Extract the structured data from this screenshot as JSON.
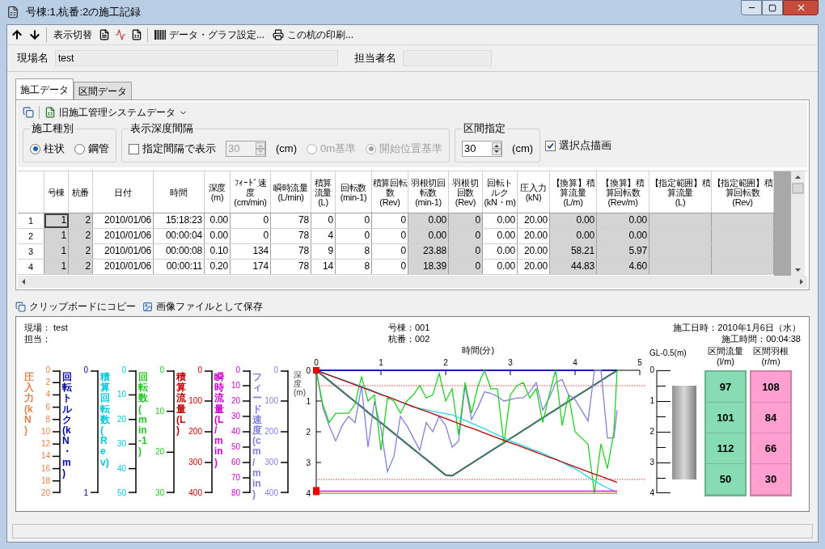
{
  "window": {
    "title": "号棟:1,杭番:2の施工記録"
  },
  "toolbar": {
    "view_toggle": "表示切替",
    "settings": "データ・グラフ設定...",
    "print": "この杭の印刷..."
  },
  "fields": [
    {
      "label": "現場名",
      "value": "test"
    },
    {
      "label": "担当者名"
    }
  ],
  "tabs": [
    {
      "label": "施工データ",
      "selected": true
    },
    {
      "label": "区間データ",
      "selected": false
    }
  ],
  "data_source": "旧施工管理システムデータ",
  "construction_type": {
    "title": "施工種別",
    "options": [
      {
        "label": "柱状",
        "selected": true
      },
      {
        "label": "鋼管",
        "selected": false
      }
    ]
  },
  "depth_interval": {
    "title": "表示深度間隔",
    "checkbox": {
      "label": "指定間隔で表示",
      "checked": false
    },
    "spin": {
      "value": "30",
      "disabled": true
    },
    "unit": "(cm)",
    "options": [
      {
        "label": "0m基準",
        "selected": false,
        "disabled": true
      },
      {
        "label": "開始位置基準",
        "selected": true,
        "disabled": true
      }
    ]
  },
  "section": {
    "title": "区間指定",
    "spin": {
      "value": "30",
      "disabled": false
    },
    "unit": "(cm)"
  },
  "draw_selected": {
    "label": "選択点描画",
    "checked": true
  },
  "table": {
    "columns": [
      {
        "label": "号棟",
        "shaded": true
      },
      {
        "label": "杭番",
        "shaded": true
      },
      {
        "label": "日付",
        "shaded": false
      },
      {
        "label": "時間",
        "shaded": false
      },
      {
        "label": "深度\n(m)",
        "shaded": false
      },
      {
        "label": "ﾌｨｰﾄﾞ速度\n(cm/min)",
        "shaded": false
      },
      {
        "label": "瞬時流量\n(L/min)",
        "shaded": false
      },
      {
        "label": "積算流量\n(L)",
        "shaded": false
      },
      {
        "label": "回転数\n(min-1)",
        "shaded": false
      },
      {
        "label": "積算回転数\n(Rev)",
        "shaded": false
      },
      {
        "label": "羽根切回転数\n(min-1)",
        "shaded": true
      },
      {
        "label": "羽根切回数\n(Rev)",
        "shaded": true
      },
      {
        "label": "回転トルク\n(kN・m)",
        "shaded": false
      },
      {
        "label": "圧入力\n(kN)",
        "shaded": false
      },
      {
        "label": "【換算】積算流量\n(L/m)",
        "shaded": true
      },
      {
        "label": "【換算】積算回転数\n(Rev/m)",
        "shaded": true
      },
      {
        "label": "【指定範囲】積算流量\n(L)",
        "shaded": true
      },
      {
        "label": "【指定範囲】積算回転数\n(Rev)",
        "shaded": true
      }
    ],
    "rows": [
      {
        "label": "1",
        "selected": true,
        "cells": [
          "1",
          "2",
          "2010/01/06",
          "15:18:23",
          "0.00",
          "0",
          "78",
          "0",
          "0",
          "0",
          "0.00",
          "0",
          "0.00",
          "20.00",
          "0.00",
          "0.00"
        ]
      },
      {
        "label": "2",
        "selected": false,
        "cells": [
          "1",
          "2",
          "2010/01/06",
          "00:00:04",
          "0.00",
          "0",
          "78",
          "4",
          "0",
          "0",
          "0.00",
          "0",
          "0.00",
          "20.00",
          "0.00",
          "0.00"
        ]
      },
      {
        "label": "3",
        "selected": false,
        "cells": [
          "1",
          "2",
          "2010/01/06",
          "00:00:08",
          "0.10",
          "134",
          "78",
          "9",
          "8",
          "0",
          "23.88",
          "0",
          "0.00",
          "20.00",
          "58.21",
          "5.97"
        ]
      },
      {
        "label": "4",
        "selected": false,
        "cells": [
          "1",
          "2",
          "2010/01/06",
          "00:00:11",
          "0.20",
          "174",
          "78",
          "14",
          "8",
          "0",
          "18.39",
          "0",
          "0.00",
          "20.00",
          "44.83",
          "4.60"
        ]
      }
    ]
  },
  "export": {
    "copy": "クリップボードにコピー",
    "save": "画像ファイルとして保存"
  },
  "report": {
    "site": "現場： test",
    "manager": "担当：",
    "building": "号棟：001",
    "pile": "杭番：002",
    "date": "施工日時：2010年1月6日（水）",
    "duration": "施工時間：00:04:38",
    "axes": [
      {
        "title": "圧入力(kN)",
        "color": "#e8804a",
        "ticks": [
          "0",
          "2",
          "4",
          "6",
          "8",
          "10",
          "12",
          "14",
          "16",
          "18",
          "20"
        ]
      },
      {
        "title": "回転トルク(kN・m)",
        "color": "#0000a8",
        "ticks": [
          "0",
          "1"
        ]
      },
      {
        "title": "積算回転数(Rev)",
        "color": "#00c8dc",
        "ticks": [
          "0",
          "10",
          "20",
          "30",
          "40",
          "50"
        ]
      },
      {
        "title": "回転数(min-1)",
        "color": "#20c820",
        "ticks": [
          "0",
          "10",
          "20",
          "30"
        ]
      },
      {
        "title": "積算流量(L)",
        "color": "#c80000",
        "ticks": [
          "0",
          "100",
          "200",
          "300",
          "400"
        ]
      },
      {
        "title": "瞬時流量(L/min)",
        "color": "#d000d0",
        "ticks": [
          "0",
          "10",
          "20",
          "30",
          "40",
          "50",
          "60",
          "70",
          "80"
        ]
      },
      {
        "title": "フィード速度(cm/min)",
        "color": "#8080dc",
        "ticks": [
          "0",
          "100",
          "200",
          "300",
          "400"
        ]
      }
    ],
    "chart_data": {
      "type": "line",
      "xlabel": "時間(分)",
      "ylabel": "深度(m)",
      "xlim": [
        0,
        5
      ],
      "ylim": [
        4,
        0
      ],
      "xticks": [
        0,
        1,
        2,
        3,
        4,
        5
      ],
      "yticks": [
        0,
        1,
        2,
        3,
        4
      ],
      "ref_lines": [
        {
          "axis": "y",
          "value": 0.5,
          "color": "#d04040"
        },
        {
          "axis": "y",
          "value": 3.55,
          "color": "#d04040"
        }
      ],
      "x": [
        0,
        0.1,
        0.2,
        0.3,
        0.4,
        0.5,
        0.6,
        0.7,
        0.8,
        0.9,
        1,
        1.1,
        1.2,
        1.3,
        1.4,
        1.5,
        1.6,
        1.7,
        1.8,
        1.9,
        2,
        2.1,
        2.2,
        2.3,
        2.4,
        2.5,
        2.6,
        2.7,
        2.8,
        2.9,
        3,
        3.1,
        3.2,
        3.3,
        3.4,
        3.5,
        3.6,
        3.7,
        3.8,
        3.9,
        4,
        4.1,
        4.2,
        4.3,
        4.4,
        4.5,
        4.6,
        4.65
      ],
      "series": [
        {
          "color": "#40706a",
          "values": [
            0,
            0.17,
            0.34,
            0.51,
            0.68,
            0.85,
            1.02,
            1.19,
            1.37,
            1.54,
            1.71,
            1.88,
            2.05,
            2.22,
            2.39,
            2.56,
            2.73,
            2.9,
            3.07,
            3.24,
            3.41,
            3.43,
            3.3,
            3.16,
            3.03,
            2.89,
            2.76,
            2.62,
            2.49,
            2.36,
            2.22,
            2.09,
            1.95,
            1.82,
            1.68,
            1.55,
            1.41,
            1.28,
            1.14,
            1.01,
            0.87,
            0.74,
            0.61,
            0.47,
            0.34,
            0.2,
            0.07,
            0
          ]
        },
        {
          "color": "#0000a8",
          "values": [
            0,
            0,
            0,
            0,
            0,
            0,
            0,
            0,
            0,
            0,
            0,
            0,
            0,
            0,
            0,
            0,
            0,
            0,
            0,
            0,
            0,
            0,
            0,
            0,
            0,
            0,
            0,
            0,
            0,
            0,
            0,
            0,
            0,
            0,
            0,
            0,
            0,
            0,
            0,
            0,
            0,
            0,
            0,
            0,
            0,
            0,
            0,
            0
          ]
        },
        {
          "color": "#8080dc",
          "values": [
            0,
            1.2,
            1.8,
            2.3,
            1.8,
            1.5,
            1.7,
            0.5,
            2.5,
            1,
            1.9,
            3.3,
            2.8,
            1.5,
            1.8,
            2.2,
            2.6,
            1.7,
            2,
            1.5,
            1.8,
            2.5,
            2.3,
            0.5,
            1.6,
            1.2,
            0.7,
            0.75,
            0.85,
            1,
            0.95,
            0.9,
            0.9,
            0.7,
            0.4,
            1.3,
            0.9,
            0.4,
            0.3,
            0.8,
            0.95,
            1.3,
            1.65,
            0,
            0,
            2.2,
            2.2,
            1.3
          ]
        },
        {
          "color": "#20d020",
          "values": [
            0,
            1.1,
            1.7,
            1.4,
            1.4,
            1.4,
            1.1,
            0.2,
            1,
            0.8,
            2.6,
            0.9,
            1,
            1.4,
            1,
            0.8,
            0.5,
            0.9,
            0.8,
            0.1,
            1,
            0.6,
            2.1,
            0.4,
            1.4,
            0.5,
            0,
            0.6,
            0.6,
            2.4,
            0.8,
            0.5,
            0.4,
            0.9,
            0.6,
            1.7,
            0.8,
            0,
            1.8,
            0.8,
            2,
            2.2,
            2.4,
            4,
            2.4,
            3.2,
            2,
            0
          ]
        },
        {
          "color": "#20d8e8",
          "values": [
            0,
            0.07,
            0.15,
            0.22,
            0.3,
            0.37,
            0.45,
            0.52,
            0.6,
            0.69,
            0.77,
            0.86,
            0.94,
            1.03,
            1.11,
            1.2,
            1.24,
            1.28,
            1.33,
            1.37,
            1.41,
            1.45,
            1.54,
            1.63,
            1.72,
            1.81,
            1.9,
            2,
            2.1,
            2.2,
            2.3,
            2.38,
            2.46,
            2.54,
            2.62,
            2.7,
            2.8,
            2.9,
            3,
            3.1,
            3.2,
            3.33,
            3.47,
            3.6,
            3.72,
            3.83,
            3.93,
            3.95
          ]
        },
        {
          "color": "#c00000",
          "values": [
            0,
            0.08,
            0.16,
            0.24,
            0.31,
            0.39,
            0.47,
            0.55,
            0.63,
            0.71,
            0.79,
            0.86,
            0.94,
            1.02,
            1.1,
            1.18,
            1.26,
            1.33,
            1.41,
            1.49,
            1.57,
            1.65,
            1.73,
            1.81,
            1.88,
            1.96,
            2.04,
            2.12,
            2.2,
            2.28,
            2.36,
            2.43,
            2.51,
            2.59,
            2.67,
            2.75,
            2.83,
            2.9,
            2.98,
            3.06,
            3.14,
            3.22,
            3.3,
            3.38,
            3.45,
            3.53,
            3.61,
            3.65
          ]
        },
        {
          "color": "#d000d0",
          "values": [
            3.93,
            3.93,
            3.93,
            3.93,
            3.93,
            3.93,
            3.93,
            3.93,
            3.93,
            3.93,
            3.93,
            3.93,
            3.93,
            3.93,
            3.93,
            3.93,
            3.93,
            3.93,
            3.93,
            3.93,
            3.93,
            3.93,
            3.93,
            3.93,
            3.93,
            3.93,
            3.93,
            3.93,
            3.93,
            3.93,
            3.93,
            3.93,
            3.93,
            3.93,
            3.93,
            3.93,
            3.93,
            3.93,
            3.93,
            3.93,
            3.93,
            3.93,
            3.93,
            3.93,
            3.93,
            3.93,
            3.93,
            3.93
          ]
        },
        {
          "color": "#e8804a",
          "values": [
            4,
            4,
            4,
            4,
            4,
            4,
            4,
            4,
            4,
            4,
            4,
            4,
            4,
            4,
            4,
            4,
            4,
            4,
            4,
            4,
            4,
            4,
            4,
            4,
            4,
            4,
            4,
            4,
            4,
            4,
            4,
            4,
            4,
            4,
            4,
            4,
            4,
            4,
            4,
            4,
            4,
            4,
            4,
            4,
            4,
            4,
            4,
            4
          ]
        }
      ]
    },
    "gl_axis": {
      "title": "GL-0.5(m)",
      "ticks": [
        "0",
        "1",
        "2",
        "3",
        "4"
      ]
    },
    "sections": [
      {
        "title": "区間流量",
        "unit": "(l/m)",
        "color": "#88dcb4",
        "values": [
          "97",
          "101",
          "112",
          "50"
        ]
      },
      {
        "title": "区間羽根",
        "unit": "(r/m)",
        "color": "#ffa0d0",
        "values": [
          "108",
          "84",
          "66",
          "30"
        ]
      }
    ]
  }
}
